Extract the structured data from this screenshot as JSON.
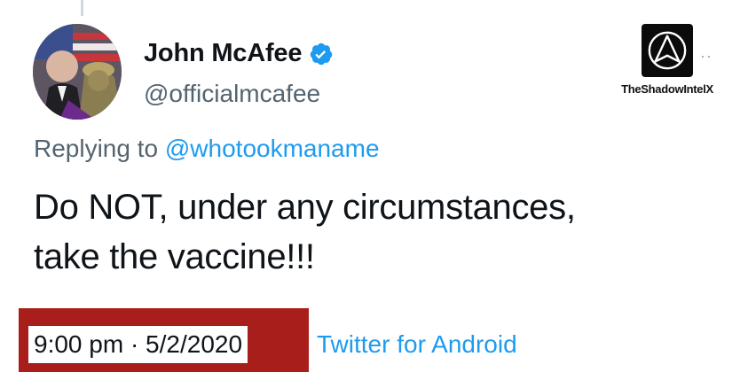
{
  "author": {
    "display_name": "John McAfee",
    "handle": "@officialmcafee",
    "verified": true,
    "avatar_icon": "profile-photo"
  },
  "watermark": {
    "label": "TheShadowIntelX",
    "icon": "delta-emblem-icon"
  },
  "reply": {
    "prefix": "Replying to",
    "mention": "@whotookmaname"
  },
  "tweet": {
    "line1": "Do NOT, under any circumstances,",
    "line2": "take the vaccine!!!"
  },
  "meta": {
    "timestamp": "9:00 pm · 5/2/2020",
    "source": "Twitter for Android"
  },
  "colors": {
    "link": "#1d9bf0",
    "secondary_text": "#536471",
    "primary_text": "#0f1419",
    "verified_badge": "#1d9bf0",
    "highlight_box": "#a81e1a"
  }
}
